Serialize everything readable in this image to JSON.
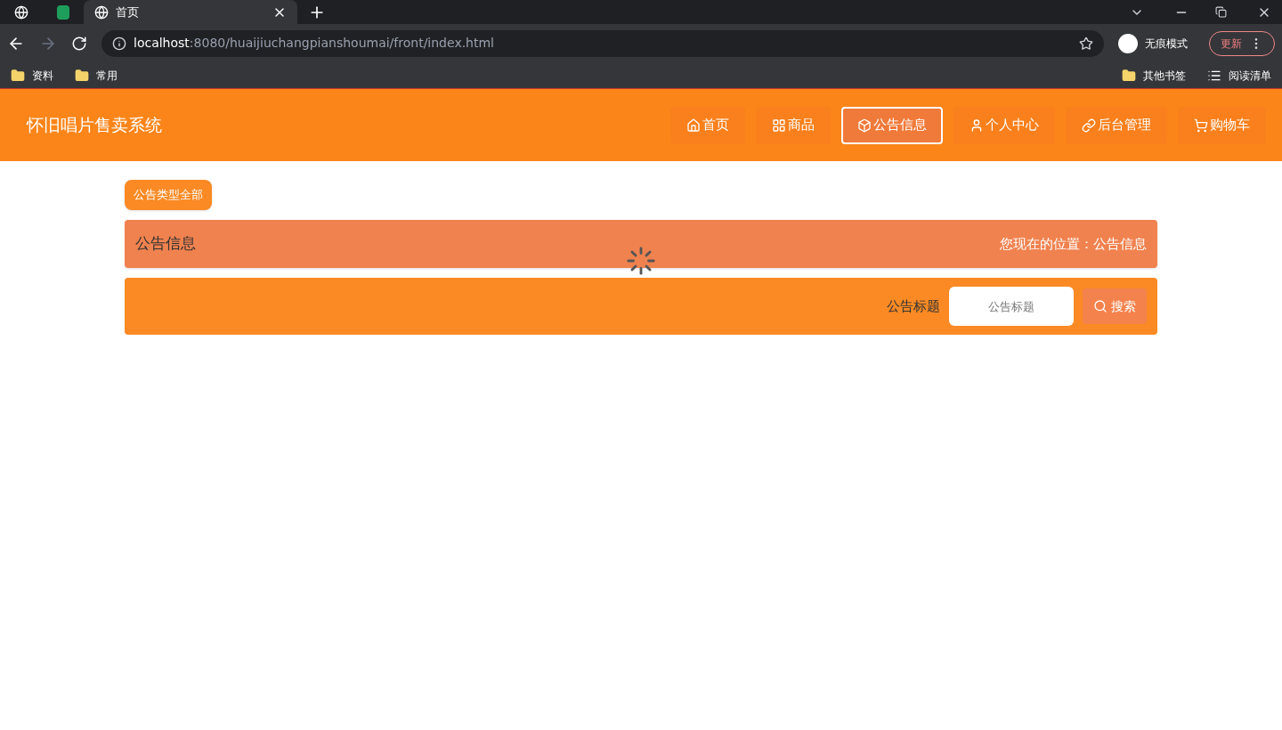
{
  "browser": {
    "tabs": [
      {
        "title": "首页",
        "selected": true
      }
    ],
    "url": {
      "host": "localhost",
      "path": ":8080/huaijiuchangpianshoumai/front/index.html"
    },
    "profile": "无痕模式",
    "update_button": "更新",
    "bookmarks": [
      "资料",
      "常用"
    ],
    "right_bookmarks": [
      "其他书签"
    ],
    "reading_list": "阅读清单"
  },
  "header": {
    "title": "怀旧唱片售卖系统",
    "nav": [
      {
        "label": "首页",
        "selected": false
      },
      {
        "label": "商品",
        "selected": false
      },
      {
        "label": "公告信息",
        "selected": true
      },
      {
        "label": "个人中心",
        "selected": false
      },
      {
        "label": "后台管理",
        "selected": false
      },
      {
        "label": "购物车",
        "selected": false
      }
    ]
  },
  "filter_button": "公告类型全部",
  "breadcrumb": {
    "title": "公告信息",
    "location_label": "您现在的位置：",
    "location": "公告信息"
  },
  "search": {
    "label": "公告标题",
    "placeholder": "公告标题",
    "button": "搜索"
  },
  "loading": true
}
